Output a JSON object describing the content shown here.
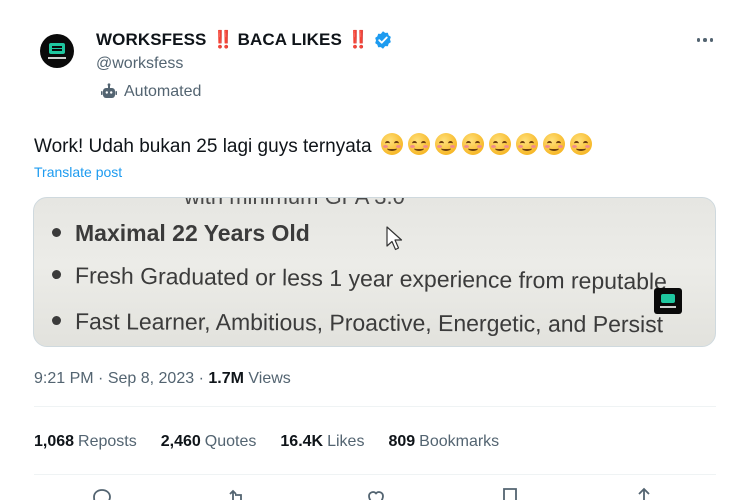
{
  "author": {
    "display_name": "WORKSFESS",
    "name_marks": [
      "‼️",
      "‼️"
    ],
    "name_middle": "BACA LIKES",
    "handle": "@worksfess",
    "automated_label": "Automated",
    "verified_color": "#1d9bf0"
  },
  "tweet": {
    "text": "Work! Udah bukan 25 lagi guys ternyata",
    "emoji": "☺️",
    "emoji_count": 8,
    "translate_label": "Translate post"
  },
  "media": {
    "cut_line": "with minimum GPA 3.0",
    "lines": [
      "Maximal 22 Years Old",
      "Fresh Graduated or less 1 year experience from reputable",
      "Fast Learner, Ambitious, Proactive, Energetic, and Persist"
    ]
  },
  "meta": {
    "time": "9:21 PM",
    "separator": "·",
    "date": "Sep 8, 2023",
    "views_count": "1.7M",
    "views_label": "Views"
  },
  "stats": [
    {
      "count": "1,068",
      "label": "Reposts"
    },
    {
      "count": "2,460",
      "label": "Quotes"
    },
    {
      "count": "16.4K",
      "label": "Likes"
    },
    {
      "count": "809",
      "label": "Bookmarks"
    }
  ],
  "icons": {
    "more": "more-icon",
    "robot": "robot-icon",
    "verified": "verified-badge-icon",
    "actions": [
      "reply-icon",
      "repost-icon",
      "like-icon",
      "bookmark-icon",
      "share-icon"
    ]
  },
  "colors": {
    "link": "#1d9bf0",
    "secondary_text": "#536471",
    "primary_text": "#0f1419",
    "bang": "#e0245e"
  }
}
